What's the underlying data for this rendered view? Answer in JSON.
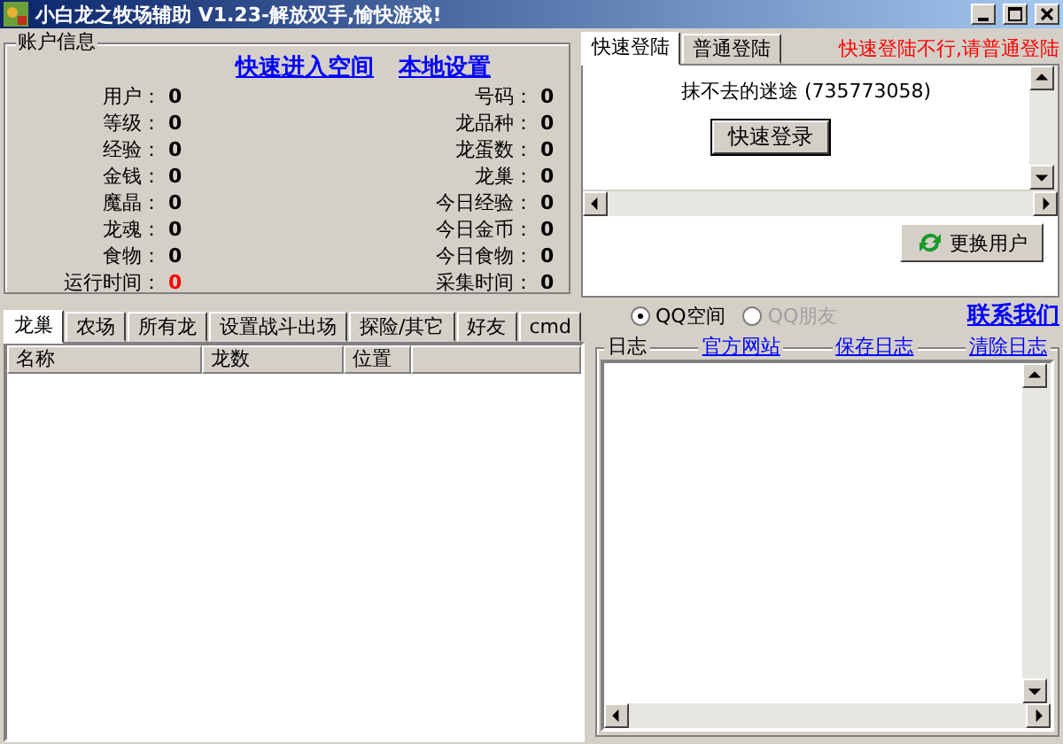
{
  "window": {
    "title": "小白龙之牧场辅助 V1.23-解放双手,愉快游戏!"
  },
  "account": {
    "legend": "账户信息",
    "links": [
      "快速进入空间",
      "本地设置"
    ],
    "left_fields": [
      {
        "label": "用户：",
        "value": "0",
        "alert": false
      },
      {
        "label": "等级：",
        "value": "0",
        "alert": false
      },
      {
        "label": "经验：",
        "value": "0",
        "alert": false
      },
      {
        "label": "金钱：",
        "value": "0",
        "alert": false
      },
      {
        "label": "魔晶：",
        "value": "0",
        "alert": false
      },
      {
        "label": "龙魂：",
        "value": "0",
        "alert": false
      },
      {
        "label": "食物：",
        "value": "0",
        "alert": false
      },
      {
        "label": "运行时间：",
        "value": "0",
        "alert": true
      }
    ],
    "right_fields": [
      {
        "label": "号码：",
        "value": "0",
        "alert": false
      },
      {
        "label": "龙品种：",
        "value": "0",
        "alert": false
      },
      {
        "label": "龙蛋数：",
        "value": "0",
        "alert": false
      },
      {
        "label": "龙巢：",
        "value": "0",
        "alert": false
      },
      {
        "label": "今日经验：",
        "value": "0",
        "alert": false
      },
      {
        "label": "今日金币：",
        "value": "0",
        "alert": false
      },
      {
        "label": "今日食物：",
        "value": "0",
        "alert": false
      },
      {
        "label": "采集时间：",
        "value": "0",
        "alert": false
      }
    ]
  },
  "login": {
    "tabs": [
      {
        "label": "快速登陆",
        "selected": true
      },
      {
        "label": "普通登陆",
        "selected": false
      }
    ],
    "notice": "快速登陆不行,请普通登陆",
    "account_text": "抹不去的迷途 (735773058)",
    "login_button": "快速登录",
    "switch_button": "更换用户"
  },
  "mode": {
    "options": [
      {
        "label": "QQ空间",
        "selected": true,
        "disabled": false
      },
      {
        "label": "QQ朋友",
        "selected": false,
        "disabled": true
      }
    ],
    "contact": "联系我们"
  },
  "main_tabs": [
    {
      "label": "龙巢",
      "selected": true
    },
    {
      "label": "农场",
      "selected": false
    },
    {
      "label": "所有龙",
      "selected": false
    },
    {
      "label": "设置战斗出场",
      "selected": false
    },
    {
      "label": "探险/其它",
      "selected": false
    },
    {
      "label": "好友",
      "selected": false
    },
    {
      "label": "cmd",
      "selected": false
    }
  ],
  "table": {
    "columns": [
      "名称",
      "龙数",
      "位置"
    ]
  },
  "log": {
    "legend": "日志",
    "links": [
      "官方网站",
      "保存日志",
      "清除日志"
    ]
  }
}
